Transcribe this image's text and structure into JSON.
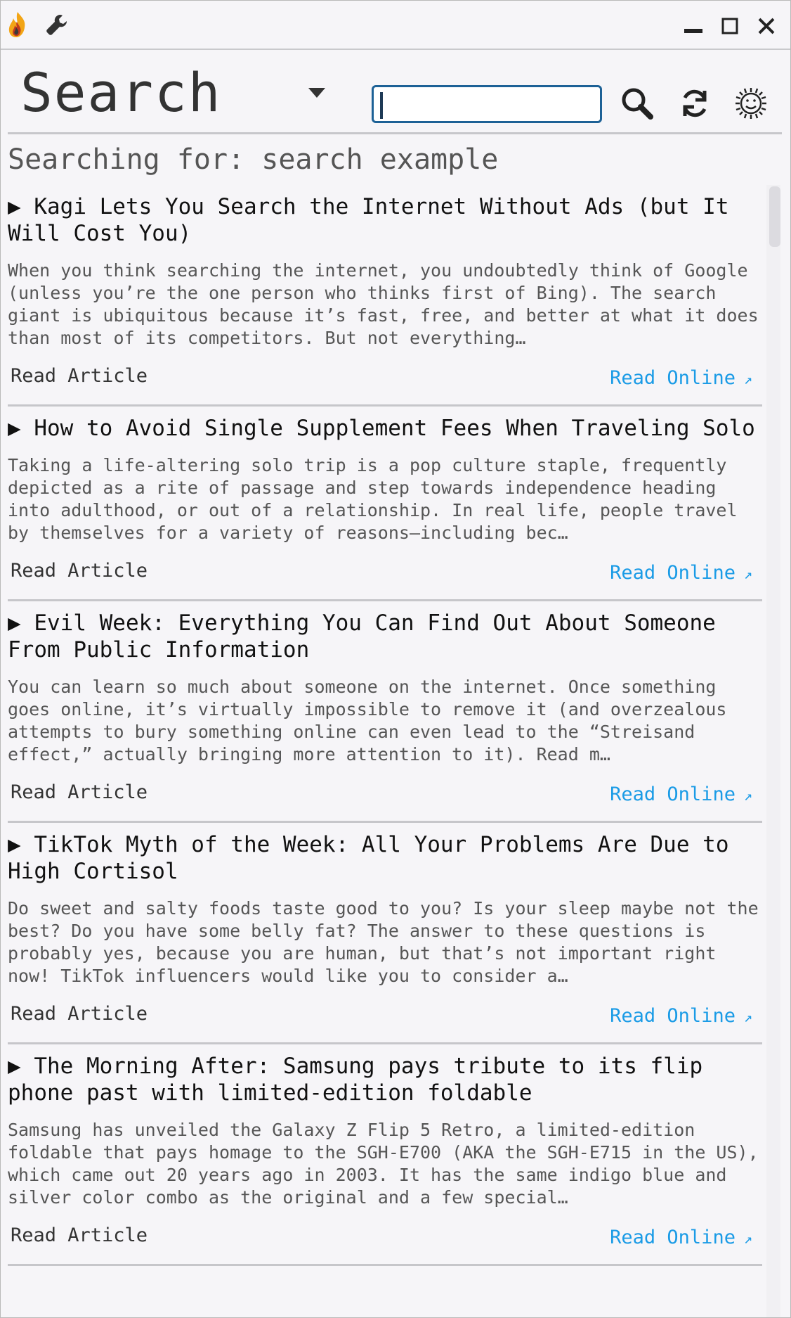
{
  "toolbar": {
    "mode_label": "Search",
    "search_value": "",
    "search_placeholder": ""
  },
  "status": {
    "searching_text": "Searching for: search example"
  },
  "results": [
    {
      "title": "▶ Kagi Lets You Search the Internet Without Ads (but It Will Cost You)",
      "excerpt": "When you think searching the internet, you undoubtedly think of Google (unless you’re the one person who thinks first of Bing). The search giant is ubiquitous because it’s fast, free, and better at what it does than most of its competitors. But not everything…",
      "read_article": "Read Article",
      "read_online": "Read Online"
    },
    {
      "title": "▶ How to Avoid Single Supplement Fees When Traveling Solo",
      "excerpt": "Taking a life-altering solo trip is a pop culture staple, frequently depicted as a rite of passage and step towards independence heading into adulthood, or out of a relationship. In real life, people travel by themselves for a variety of reasons—including bec…",
      "read_article": "Read Article",
      "read_online": "Read Online"
    },
    {
      "title": "▶ Evil Week: Everything You Can Find Out About Someone From Public Information",
      "excerpt": "You can learn so much about someone on the internet. Once something goes online, it’s virtually impossible to remove it (and overzealous attempts to bury something online can even lead to the “Streisand effect,” actually bringing more attention to it). Read m…",
      "read_article": "Read Article",
      "read_online": "Read Online"
    },
    {
      "title": "▶ TikTok Myth of the Week: All Your Problems Are Due to High Cortisol",
      "excerpt": "Do sweet and salty foods taste good to you? Is your sleep maybe not the best? Do you have some belly fat? The answer to these questions is probably yes, because you are human, but that’s not important right now! TikTok influencers would like you to consider a…",
      "read_article": "Read Article",
      "read_online": "Read Online"
    },
    {
      "title": "▶ The Morning After: Samsung pays tribute to its flip phone past with limited-edition foldable",
      "excerpt": "Samsung has unveiled the Galaxy Z Flip 5 Retro, a limited-edition foldable that pays homage to the SGH-E700 (AKA the SGH-E715 in the US), which came out 20 years ago in 2003. It has the same indigo blue and silver color combo as the original and a few special…",
      "read_article": "Read Article",
      "read_online": "Read Online"
    }
  ],
  "icons": {
    "app": "flame-icon",
    "tools": "wrench-icon",
    "minimize": "minimize-icon",
    "maximize": "maximize-icon",
    "close": "close-icon",
    "dropdown": "caret-down-icon",
    "search": "magnifier-icon",
    "refresh": "refresh-icon",
    "theme": "sun-face-icon",
    "external": "external-link-icon"
  },
  "colors": {
    "accent": "#1a9be6",
    "focus_border": "#1d6196"
  }
}
